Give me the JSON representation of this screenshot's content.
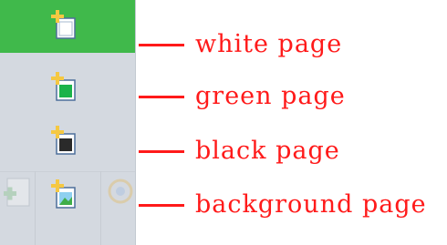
{
  "toolbar": {
    "buttons": [
      {
        "name": "white-page",
        "icon": "new-white-page-icon",
        "page_color": "#ffffff",
        "active": true
      },
      {
        "name": "green-page",
        "icon": "new-green-page-icon",
        "page_color": "#1bb34a",
        "active": false
      },
      {
        "name": "black-page",
        "icon": "new-black-page-icon",
        "page_color": "#2a2a2a",
        "active": false
      },
      {
        "name": "background-page",
        "icon": "new-background-page-icon",
        "page_color": "#3fae49",
        "active": false
      }
    ]
  },
  "annotations": {
    "white_page": "white page",
    "green_page": "green page",
    "black_page": "black page",
    "background_page": "background page"
  },
  "colors": {
    "toolbar_bg": "#d4d9e0",
    "active_bg": "#40b94b",
    "annotation": "#ff1a1a",
    "plus_sign": "#f5c842"
  }
}
